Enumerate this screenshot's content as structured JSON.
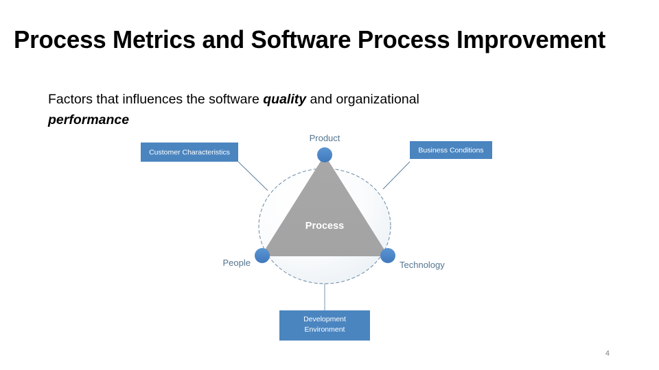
{
  "slide": {
    "title": "Process Metrics and Software Process Improvement",
    "page_number": "4",
    "body": {
      "line1_part1": "Factors that influences the software ",
      "line1_emphasis": "quality",
      "line1_part2": " and ",
      "line1_part3": "organizational",
      "line2_emphasis": "performance"
    }
  },
  "diagram": {
    "type": "radial-venn",
    "center_label": "Process",
    "nodes": [
      {
        "label": "Product",
        "position": "top"
      },
      {
        "label": "People",
        "position": "bottom-left"
      },
      {
        "label": "Technology",
        "position": "bottom-right"
      }
    ],
    "boxes": [
      {
        "label": "Customer Characteristics",
        "position": "top-left"
      },
      {
        "label": "Business Conditions",
        "position": "top-right"
      },
      {
        "label_line1": "Development",
        "label_line2": "Environment",
        "position": "bottom"
      }
    ],
    "colors": {
      "box_fill": "#4a85c0",
      "node_fill": "#4a86c8",
      "triangle_fill": "#a6a6a6",
      "circle_stroke": "#5b7d9a",
      "connector_stroke": "#5b7d9a",
      "label_text": "#54758f",
      "box_text": "#ffffff"
    }
  }
}
